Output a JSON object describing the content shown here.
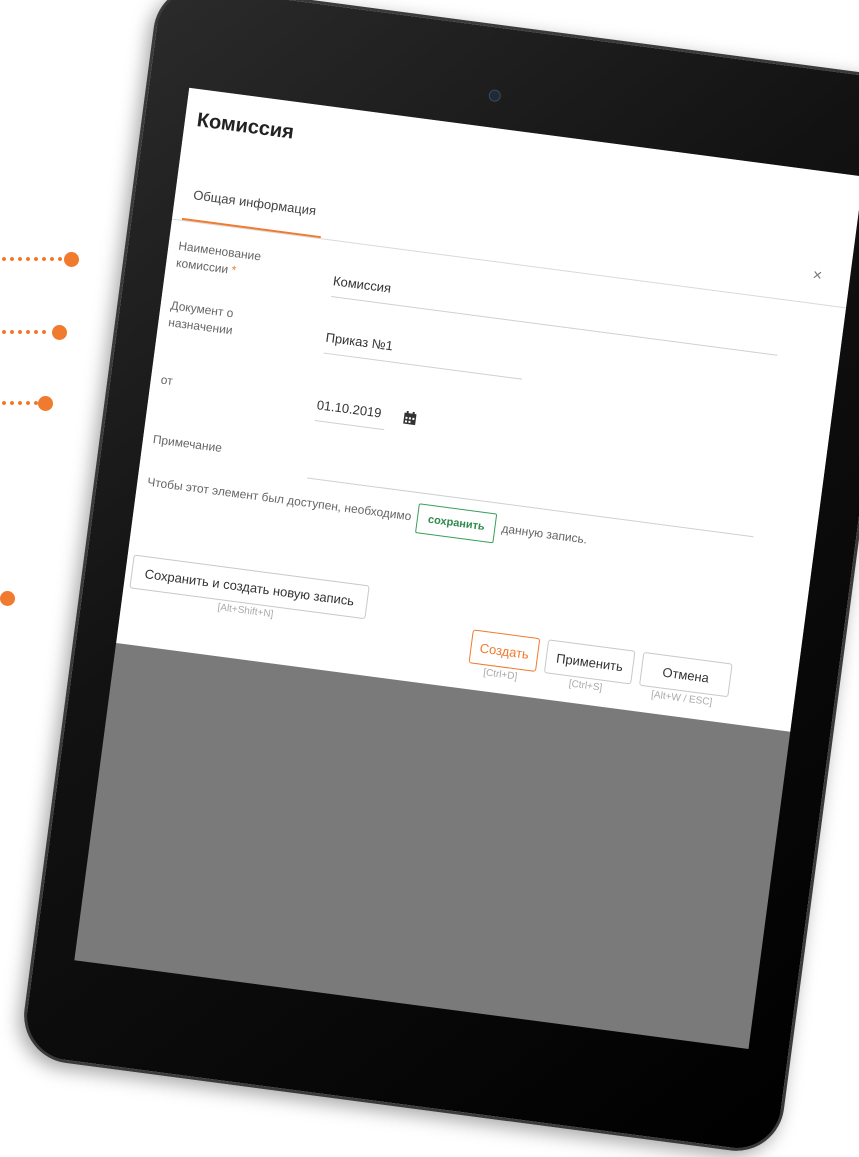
{
  "dialog": {
    "title": "Комиссия",
    "close_label": "×",
    "tabs": [
      {
        "label": "Общая информация"
      }
    ],
    "fields": {
      "name": {
        "label_line1": "Наименование",
        "label_line2": "комиссии",
        "required_mark": "*",
        "value": "Комиссия"
      },
      "document": {
        "label_line1": "Документ о",
        "label_line2": "назначении",
        "value": "Приказ №1"
      },
      "date": {
        "label": "от",
        "value": "01.10.2019"
      },
      "note": {
        "label": "Примечание",
        "value": ""
      }
    },
    "notice": {
      "before": "Чтобы этот элемент был доступен, необходимо",
      "button_label": "сохранить",
      "after": "данную запись."
    },
    "buttons": {
      "save_new": {
        "label": "Сохранить и создать новую запись",
        "hint": "[Alt+Shift+N]"
      },
      "create": {
        "label": "Создать",
        "hint": "[Ctrl+D]"
      },
      "apply": {
        "label": "Применить",
        "hint": "[Ctrl+S]"
      },
      "cancel": {
        "label": "Отмена",
        "hint": "[Alt+W / ESC]"
      }
    }
  },
  "colors": {
    "accent": "#f07a2e",
    "save_green": "#2e8a4d",
    "bezel": "#111111",
    "screen_bg": "#7a7a7a"
  },
  "icons": {
    "calendar": "calendar-icon",
    "close": "close-icon"
  }
}
